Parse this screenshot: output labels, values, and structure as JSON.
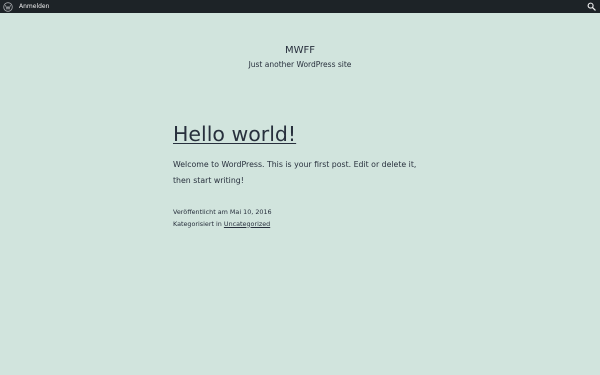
{
  "adminbar": {
    "logo_icon": "wordpress-icon",
    "login_label": "Anmelden",
    "search_icon": "search-icon",
    "background": "#1d2327"
  },
  "site": {
    "title": "MWFF",
    "description": "Just another WordPress site"
  },
  "post": {
    "title": "Hello world!",
    "content": "Welcome to WordPress. This is your first post. Edit or delete it, then start writing!",
    "published_label": "Veröffentlicht am Mai 10, 2016",
    "categories_prefix": "Kategorisiert in",
    "category": "Uncategorized"
  },
  "colors": {
    "background": "#d1e4dd",
    "text": "#28303d"
  }
}
